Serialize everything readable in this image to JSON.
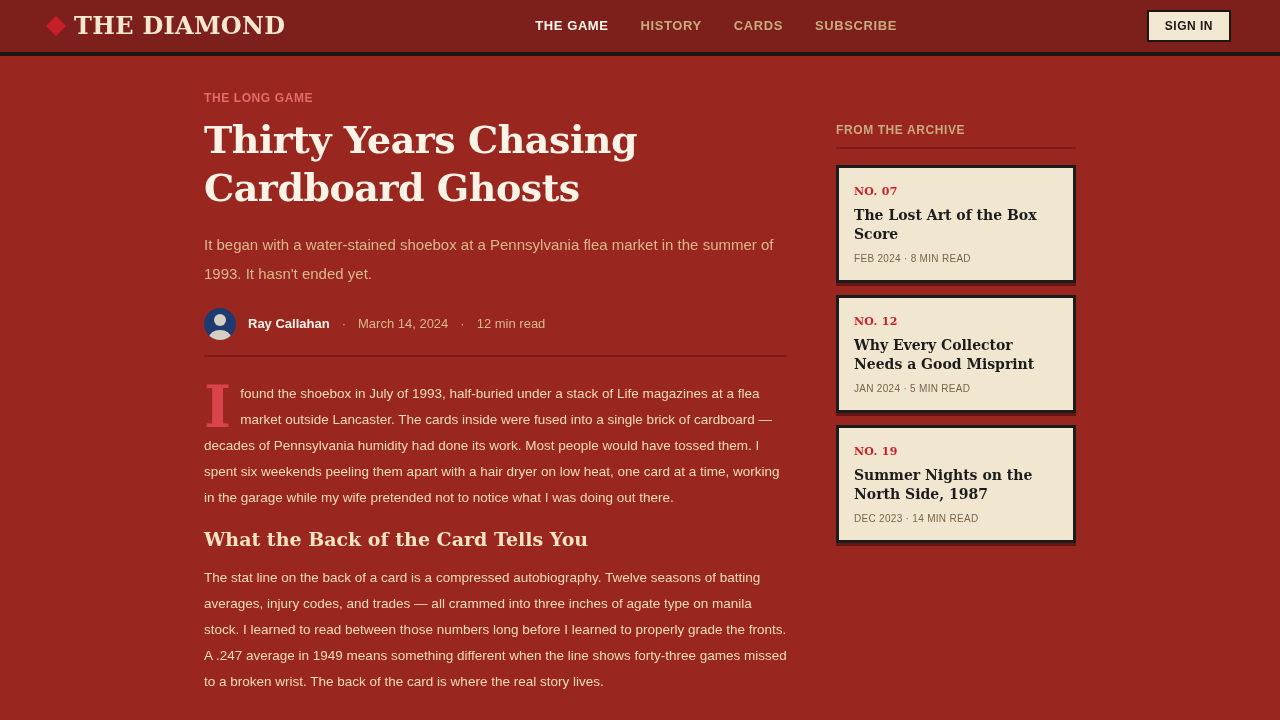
{
  "header": {
    "logo": "THE DIAMOND",
    "nav": [
      {
        "label": "THE GAME",
        "selected": true
      },
      {
        "label": "HISTORY",
        "selected": false
      },
      {
        "label": "CARDS",
        "selected": false
      },
      {
        "label": "SUBSCRIBE",
        "selected": false
      }
    ],
    "sign_in": "SIGN IN"
  },
  "article": {
    "kicker": "THE LONG GAME",
    "title": "Thirty Years Chasing Cardboard Ghosts",
    "subtitle": "It began with a water-stained shoebox at a Pennsylvania flea market in the summer of 1993. It hasn't ended yet.",
    "byline": [
      {
        "kind": "author",
        "text": "Ray Callahan"
      },
      {
        "kind": "separator",
        "text": "·"
      },
      {
        "kind": "meta",
        "text": "March 14, 2024"
      },
      {
        "kind": "separator",
        "text": "·"
      },
      {
        "kind": "meta",
        "text": "12 min read"
      }
    ],
    "body": [
      {
        "kind": "paragraph",
        "drop_cap": true,
        "text": "I found the shoebox in July of 1993, half-buried under a stack of Life magazines at a flea market outside Lancaster. The cards inside were fused into a single brick of cardboard — decades of Pennsylvania humidity had done its work. Most people would have tossed them. I spent six weekends peeling them apart with a hair dryer on low heat, one card at a time, working in the garage while my wife pretended not to notice what I was doing out there."
      },
      {
        "kind": "heading",
        "text": "What the Back of the Card Tells You"
      },
      {
        "kind": "paragraph",
        "drop_cap": false,
        "text": "The stat line on the back of a card is a compressed autobiography. Twelve seasons of batting averages, injury codes, and trades — all crammed into three inches of agate type on manila stock. I learned to read between those numbers long before I learned to properly grade the fronts. A .247 average in 1949 means something different when the line shows forty-three games missed to a broken wrist. The back of the card is where the real story lives."
      }
    ]
  },
  "sidebar": {
    "heading": "FROM THE ARCHIVE",
    "items": [
      {
        "number": "NO. 07",
        "title": "The Lost Art of the Box Score",
        "meta": "FEB 2024 · 8 MIN READ"
      },
      {
        "number": "NO. 12",
        "title": "Why Every Collector Needs a Good Misprint",
        "meta": "JAN 2024 · 5 MIN READ"
      },
      {
        "number": "NO. 19",
        "title": "Summer Nights on the North Side, 1987",
        "meta": "DEC 2023 · 14 MIN READ"
      }
    ]
  }
}
